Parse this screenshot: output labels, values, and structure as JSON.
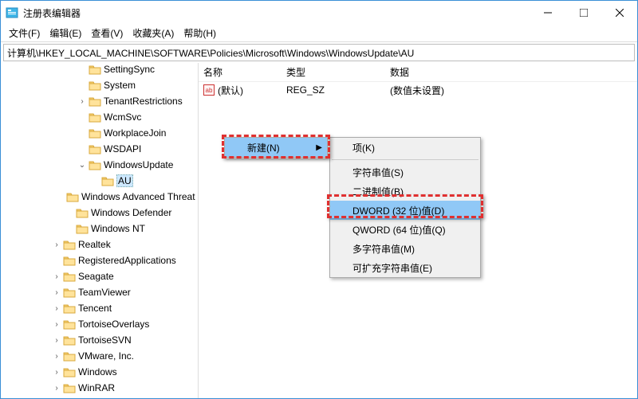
{
  "window": {
    "title": "注册表编辑器"
  },
  "menubar": [
    "文件(F)",
    "编辑(E)",
    "查看(V)",
    "收藏夹(A)",
    "帮助(H)"
  ],
  "address": "计算机\\HKEY_LOCAL_MACHINE\\SOFTWARE\\Policies\\Microsoft\\Windows\\WindowsUpdate\\AU",
  "tree": [
    {
      "i": 6,
      "e": "",
      "t": "SettingSync"
    },
    {
      "i": 6,
      "e": "",
      "t": "System"
    },
    {
      "i": 6,
      "e": ">",
      "t": "TenantRestrictions"
    },
    {
      "i": 6,
      "e": "",
      "t": "WcmSvc"
    },
    {
      "i": 6,
      "e": "",
      "t": "WorkplaceJoin"
    },
    {
      "i": 6,
      "e": "",
      "t": "WSDAPI"
    },
    {
      "i": 6,
      "e": "v",
      "t": "WindowsUpdate"
    },
    {
      "i": 7,
      "e": "",
      "t": "AU",
      "sel": true
    },
    {
      "i": 5,
      "e": "",
      "t": "Windows Advanced Threat Protection"
    },
    {
      "i": 5,
      "e": "",
      "t": "Windows Defender"
    },
    {
      "i": 5,
      "e": "",
      "t": "Windows NT"
    },
    {
      "i": 4,
      "e": ">",
      "t": "Realtek"
    },
    {
      "i": 4,
      "e": "",
      "t": "RegisteredApplications"
    },
    {
      "i": 4,
      "e": ">",
      "t": "Seagate"
    },
    {
      "i": 4,
      "e": ">",
      "t": "TeamViewer"
    },
    {
      "i": 4,
      "e": ">",
      "t": "Tencent"
    },
    {
      "i": 4,
      "e": ">",
      "t": "TortoiseOverlays"
    },
    {
      "i": 4,
      "e": ">",
      "t": "TortoiseSVN"
    },
    {
      "i": 4,
      "e": ">",
      "t": "VMware, Inc."
    },
    {
      "i": 4,
      "e": ">",
      "t": "Windows"
    },
    {
      "i": 4,
      "e": ">",
      "t": "WinRAR"
    }
  ],
  "list": {
    "headers": {
      "name": "名称",
      "type": "类型",
      "data": "数据"
    },
    "rows": [
      {
        "name": "(默认)",
        "type": "REG_SZ",
        "data": "(数值未设置)"
      }
    ]
  },
  "context_menu_1": {
    "new": "新建(N)"
  },
  "context_menu_2": [
    {
      "t": "项(K)"
    },
    {
      "sep": true
    },
    {
      "t": "字符串值(S)"
    },
    {
      "t": "二进制值(B)"
    },
    {
      "t": "DWORD (32 位)值(D)",
      "hi": true
    },
    {
      "t": "QWORD (64 位)值(Q)"
    },
    {
      "t": "多字符串值(M)"
    },
    {
      "t": "可扩充字符串值(E)"
    }
  ]
}
